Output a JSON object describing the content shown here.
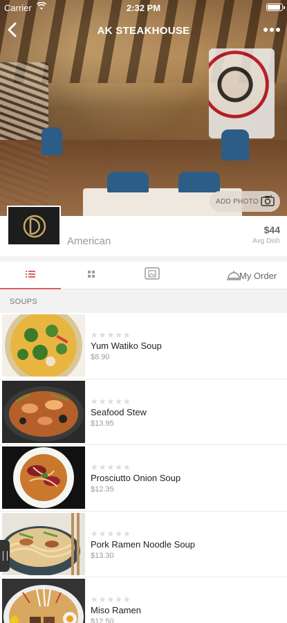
{
  "status": {
    "carrier": "Carrier",
    "time": "2:32 PM"
  },
  "nav": {
    "title": "AK STEAKHOUSE"
  },
  "hero": {
    "add_photo_label": "ADD PHOTO"
  },
  "restaurant": {
    "cuisine": "American",
    "avg_price": "$44",
    "avg_label": "Avg Dish"
  },
  "tabs": {
    "order_label": "My Order"
  },
  "section": {
    "title": "SOUPS"
  },
  "items": [
    {
      "name": "Yum Watiko Soup",
      "price": "$8.90",
      "rating": "★★★★★",
      "rating_value": 0
    },
    {
      "name": "Seafood Stew",
      "price": "$13.95",
      "rating": "★★★★★",
      "rating_value": 0
    },
    {
      "name": "Prosciutto Onion Soup",
      "price": "$12.35",
      "rating": "★★★★★",
      "rating_value": 0
    },
    {
      "name": "Pork Ramen Noodle Soup",
      "price": "$13.30",
      "rating": "★★★★★",
      "rating_value": 0
    },
    {
      "name": "Miso Ramen",
      "price": "$12.50",
      "rating": "★★★★★",
      "rating_value": 0
    }
  ],
  "colors": {
    "accent": "#e45a5a",
    "chair_blue": "#2c5d86"
  }
}
